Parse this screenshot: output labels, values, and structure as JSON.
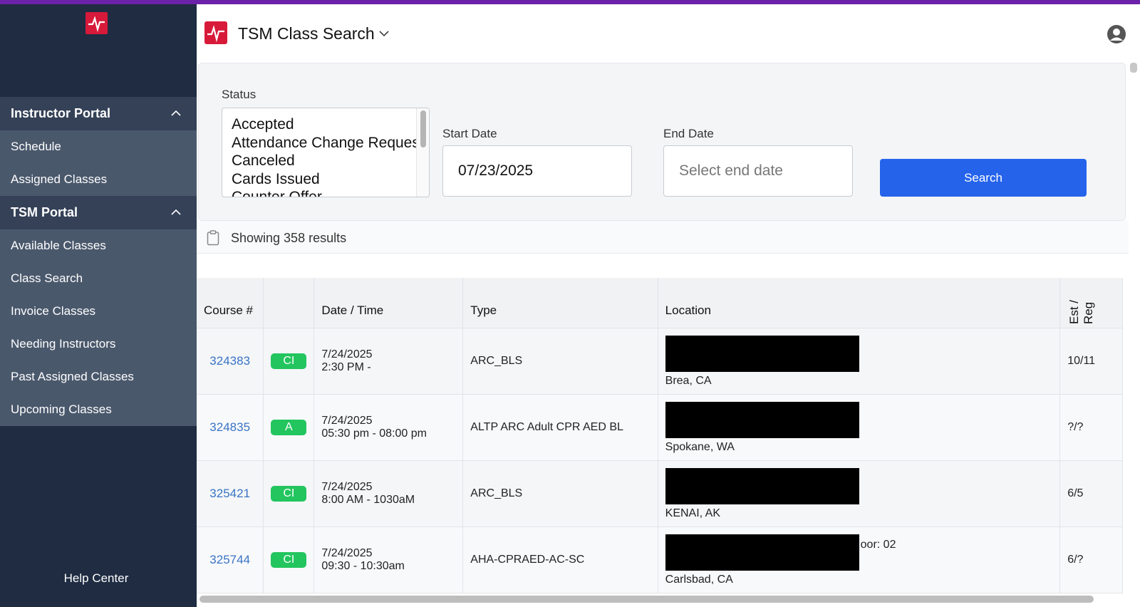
{
  "sidebar": {
    "sections": [
      {
        "title": "Instructor Portal",
        "items": [
          "Schedule",
          "Assigned Classes"
        ]
      },
      {
        "title": "TSM Portal",
        "items": [
          "Available Classes",
          "Class Search",
          "Invoice Classes",
          "Needing Instructors",
          "Past Assigned Classes",
          "Upcoming Classes"
        ]
      }
    ],
    "help": "Help Center"
  },
  "header": {
    "title": "TSM Class Search"
  },
  "filters": {
    "status_label": "Status",
    "status_options": [
      "Accepted",
      "Attendance Change Request",
      "Canceled",
      "Cards Issued",
      "Counter Offer"
    ],
    "start_label": "Start Date",
    "start_value": "07/23/2025",
    "end_label": "End Date",
    "end_placeholder": "Select end date",
    "search_label": "Search"
  },
  "results": {
    "text": "Showing 358 results"
  },
  "table": {
    "headers": {
      "course": "Course #",
      "status": "",
      "datetime": "Date / Time",
      "type": "Type",
      "location": "Location",
      "est_reg": "Est / Reg"
    },
    "rows": [
      {
        "course": "324383",
        "badge": "CI",
        "date": "7/24/2025",
        "time": "2:30 PM -",
        "type": "ARC_BLS",
        "city": "Brea, CA",
        "extra": "",
        "est": "10/11"
      },
      {
        "course": "324835",
        "badge": "A",
        "date": "7/24/2025",
        "time": "05:30 pm - 08:00 pm",
        "type": "ALTP ARC Adult CPR AED BL",
        "city": "Spokane, WA",
        "extra": "",
        "est": "?/?"
      },
      {
        "course": "325421",
        "badge": "CI",
        "date": "7/24/2025",
        "time": "8:00 AM - 1030aM",
        "type": "ARC_BLS",
        "city": "KENAI, AK",
        "extra": "",
        "est": "6/5"
      },
      {
        "course": "325744",
        "badge": "CI",
        "date": "7/24/2025",
        "time": "09:30 - 10:30am",
        "type": "AHA-CPRAED-AC-SC",
        "city": "Carlsbad, CA",
        "extra": "oor: 02",
        "est": "6/?"
      }
    ]
  },
  "colors": {
    "accent": "#2563eb",
    "brand": "#d71a3a",
    "badge": "#22c55e",
    "sidebar": "#1f2c42"
  }
}
